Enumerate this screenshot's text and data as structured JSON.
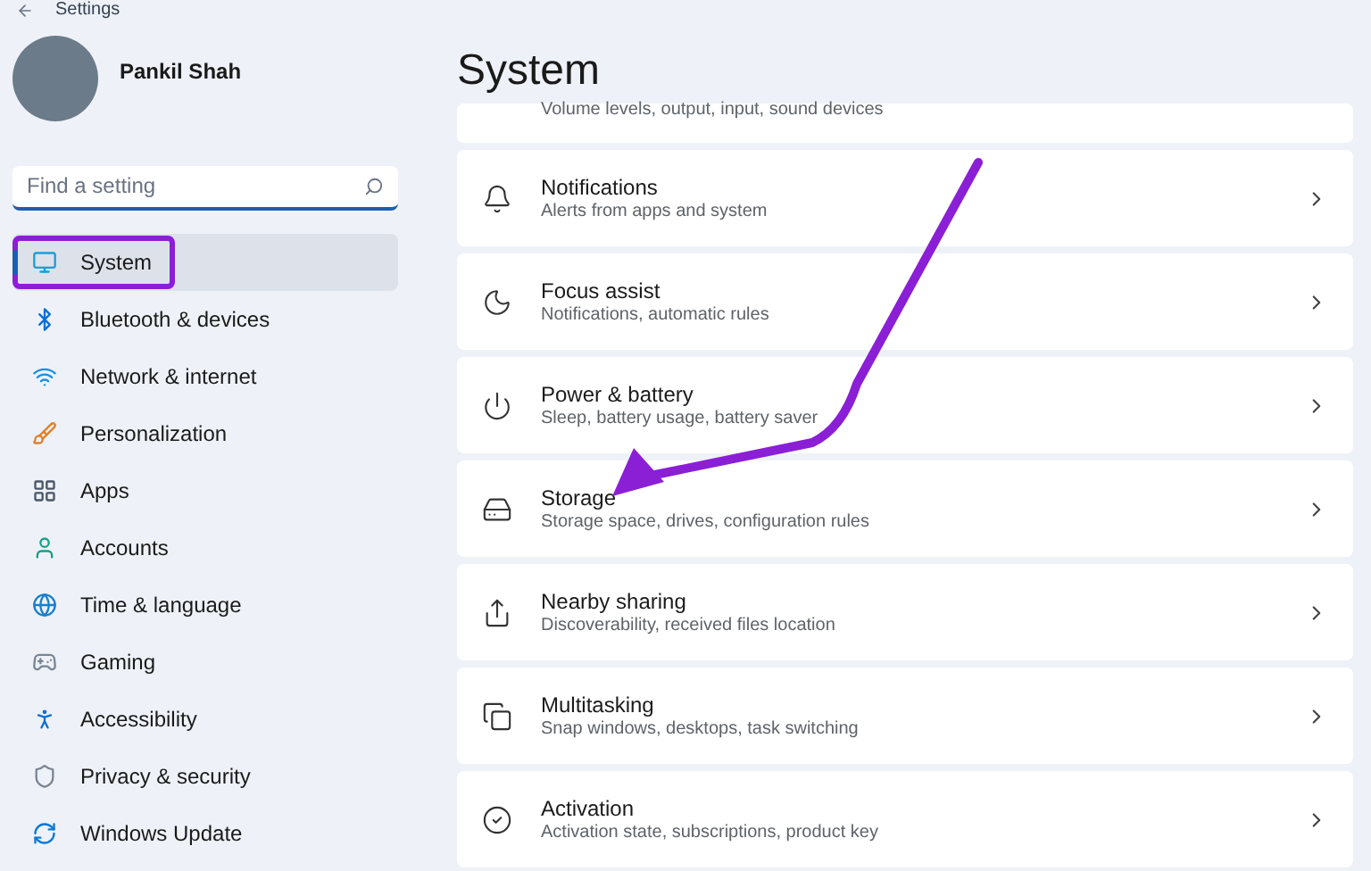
{
  "window": {
    "title": "Settings"
  },
  "user": {
    "name": "Pankil Shah"
  },
  "search": {
    "placeholder": "Find a setting"
  },
  "sidebar": {
    "items": [
      {
        "label": "System",
        "selected": true,
        "highlighted": true
      },
      {
        "label": "Bluetooth & devices",
        "selected": false,
        "highlighted": false
      },
      {
        "label": "Network & internet",
        "selected": false,
        "highlighted": false
      },
      {
        "label": "Personalization",
        "selected": false,
        "highlighted": false
      },
      {
        "label": "Apps",
        "selected": false,
        "highlighted": false
      },
      {
        "label": "Accounts",
        "selected": false,
        "highlighted": false
      },
      {
        "label": "Time & language",
        "selected": false,
        "highlighted": false
      },
      {
        "label": "Gaming",
        "selected": false,
        "highlighted": false
      },
      {
        "label": "Accessibility",
        "selected": false,
        "highlighted": false
      },
      {
        "label": "Privacy & security",
        "selected": false,
        "highlighted": false
      },
      {
        "label": "Windows Update",
        "selected": false,
        "highlighted": false
      }
    ]
  },
  "page": {
    "title": "System",
    "partial_card": {
      "subtitle": "Volume levels, output, input, sound devices"
    },
    "cards": [
      {
        "title": "Notifications",
        "subtitle": "Alerts from apps and system"
      },
      {
        "title": "Focus assist",
        "subtitle": "Notifications, automatic rules"
      },
      {
        "title": "Power & battery",
        "subtitle": "Sleep, battery usage, battery saver"
      },
      {
        "title": "Storage",
        "subtitle": "Storage space, drives, configuration rules"
      },
      {
        "title": "Nearby sharing",
        "subtitle": "Discoverability, received files location"
      },
      {
        "title": "Multitasking",
        "subtitle": "Snap windows, desktops, task switching"
      },
      {
        "title": "Activation",
        "subtitle": "Activation state, subscriptions, product key"
      }
    ]
  }
}
